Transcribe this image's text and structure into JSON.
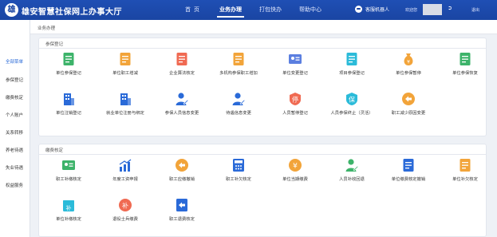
{
  "header": {
    "logo_glyph": "雄",
    "title": "雄安智慧社保网上办事大厅",
    "nav": [
      "首页",
      "业务办理",
      "打包快办",
      "帮助中心"
    ],
    "active_nav": 1,
    "robot_label": "客服机器人",
    "welcome": "欢迎您",
    "logout": "退出"
  },
  "sidebar": {
    "items": [
      "全部菜单",
      "参保登记",
      "缴费核定",
      "个人账户",
      "关系转移",
      "养老待遇",
      "失业待遇",
      "权益服务"
    ],
    "active": 0
  },
  "breadcrumb": "业务办理",
  "sections": [
    {
      "title": "参保登记",
      "tiles": [
        {
          "label": "单位参保登记",
          "icon": "doc-pen-icon",
          "color": "#3db36a"
        },
        {
          "label": "单位职工增减",
          "icon": "list-plus-icon",
          "color": "#f2a43a"
        },
        {
          "label": "企业算法核定",
          "icon": "list-check-icon",
          "color": "#f06a52"
        },
        {
          "label": "多机构参保职工增加",
          "icon": "list-plus-icon",
          "color": "#f2a43a"
        },
        {
          "label": "单位变更登记",
          "icon": "card-edit-icon",
          "color": "#5b7fe0"
        },
        {
          "label": "项目参保登记",
          "icon": "doc-pencil-icon",
          "color": "#2bbbd9"
        },
        {
          "label": "单位参保暂停",
          "icon": "money-bag-icon",
          "color": "#f2a43a"
        },
        {
          "label": "单位参保恢复",
          "icon": "doc-refresh-icon",
          "color": "#3db36a"
        },
        {
          "label": "单位注销登记",
          "icon": "building-icon",
          "color": "#2a6ad8"
        },
        {
          "label": "就业单位注册与绑定",
          "icon": "building-icon",
          "color": "#2a6ad8"
        },
        {
          "label": "参保人员信息变更",
          "icon": "person-edit-icon",
          "color": "#2a6ad8"
        },
        {
          "label": "待遇信息变更",
          "icon": "person-edit-icon",
          "color": "#2a6ad8"
        },
        {
          "label": "人员暂停登记",
          "icon": "stop-badge-icon",
          "color": "#f06a52"
        },
        {
          "label": "人员参保终止（灵活）",
          "icon": "insure-shield-icon",
          "color": "#2bbbd9"
        },
        {
          "label": "职工减少原因变更",
          "icon": "back-arrow-icon",
          "color": "#f2a43a"
        }
      ]
    },
    {
      "title": "缴费核定",
      "tiles": [
        {
          "label": "职工补缴核定",
          "icon": "id-card-icon",
          "color": "#3db36a"
        },
        {
          "label": "年度工资申报",
          "icon": "bar-chart-icon",
          "color": "#2a6ad8"
        },
        {
          "label": "职工应缴撤销",
          "icon": "back-arrow-icon",
          "color": "#f2a43a"
        },
        {
          "label": "职工补欠核定",
          "icon": "calc-icon",
          "color": "#2a6ad8"
        },
        {
          "label": "单位当期缴费",
          "icon": "yuan-circle-icon",
          "color": "#f2a43a"
        },
        {
          "label": "人员补收回退",
          "icon": "person-yuan-icon",
          "color": "#3db36a"
        },
        {
          "label": "单位缴费核定撤销",
          "icon": "doc-blue-icon",
          "color": "#2a6ad8"
        },
        {
          "label": "单位补欠核定",
          "icon": "doc-orange-icon",
          "color": "#f2a43a"
        },
        {
          "label": "单位补缴核定",
          "icon": "calendar-icon",
          "color": "#2bbbd9"
        },
        {
          "label": "退役士兵缴费",
          "icon": "coin-icon",
          "color": "#f06a52"
        },
        {
          "label": "职工退费核定",
          "icon": "return-icon",
          "color": "#2a6ad8"
        }
      ]
    }
  ]
}
